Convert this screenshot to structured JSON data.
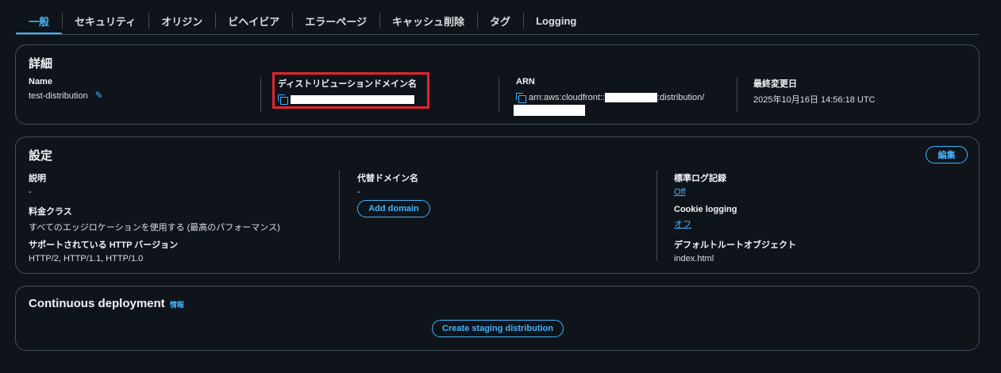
{
  "tabs": [
    "一般",
    "セキュリティ",
    "オリジン",
    "ビヘイビア",
    "エラーページ",
    "キャッシュ削除",
    "タグ",
    "Logging"
  ],
  "details": {
    "title": "詳細",
    "name_label": "Name",
    "name_value": "test-distribution",
    "domain_label": "ディストリビューションドメイン名",
    "arn_label": "ARN",
    "arn_prefix": "arn:aws:cloudfront::",
    "arn_mid": ":distribution/",
    "modified_label": "最終変更日",
    "modified_value": "2025年10月16日 14:56:18 UTC"
  },
  "settings": {
    "title": "設定",
    "edit_button": "編集",
    "description_label": "説明",
    "description_value": "-",
    "price_label": "料金クラス",
    "price_value": "すべてのエッジロケーションを使用する (最高のパフォーマンス)",
    "http_label": "サポートされている HTTP バージョン",
    "http_value": "HTTP/2, HTTP/1.1, HTTP/1.0",
    "alt_domain_label": "代替ドメイン名",
    "alt_domain_value": "-",
    "add_domain_button": "Add domain",
    "std_log_label": "標準ログ記録",
    "std_log_value": "Off",
    "cookie_label": "Cookie logging",
    "cookie_value": "オフ",
    "root_label": "デフォルトルートオブジェクト",
    "root_value": "index.html"
  },
  "cd": {
    "title": "Continuous deployment",
    "info": "情報",
    "staging_button": "Create staging distribution"
  },
  "colors": {
    "accent": "#42b4ff",
    "highlight": "#e3242b",
    "border": "#414d5c"
  }
}
